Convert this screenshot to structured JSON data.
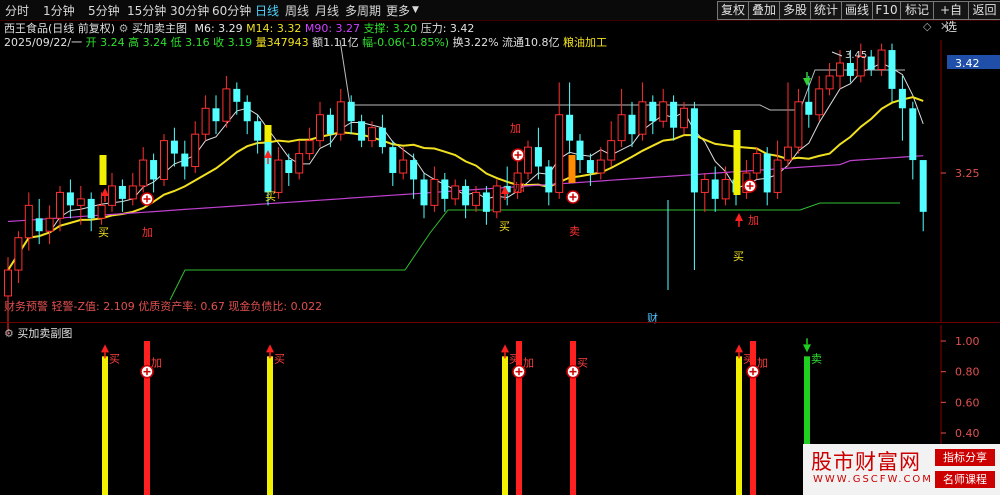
{
  "toolbar": {
    "periods": [
      "分时",
      "1分钟",
      "5分钟",
      "15分钟",
      "30分钟",
      "60分钟",
      "日线",
      "周线",
      "月线",
      "多周期",
      "更多"
    ],
    "active": "日线",
    "right_buttons": [
      "复权",
      "叠加",
      "多股",
      "统计",
      "画线",
      "F10",
      "标记",
      "+自选",
      "返回"
    ]
  },
  "info": {
    "stock": "西王食品(日线 前复权)",
    "indicator": "买加卖主图",
    "m6": "M6: 3.29",
    "m14": "M14: 3.32",
    "m90": "M90: 3.27",
    "support": "支撑: 3.20",
    "pressure": "压力: 3.42",
    "date": "2025/09/22/一",
    "open": "开 3.24",
    "high": "高 3.24",
    "low": "低 3.16",
    "close": "收 3.19",
    "volume": "量347943",
    "amount": "额1.11亿",
    "change": "幅-0.06(-1.85%)",
    "turnover": "换3.22%",
    "float": "流通10.8亿",
    "industry": "粮油加工"
  },
  "main_chart": {
    "price_labels": [
      "3.42",
      "3.25"
    ],
    "peak_label": "3.45",
    "financial_note": "财务预警 轻警-Z值: 2.109 优质资产率: 0.67 现金负债比: 0.022",
    "financial_marker": "财",
    "signals": [
      {
        "text": "买",
        "color": "#f0e020"
      },
      {
        "text": "加",
        "color": "#ff3030"
      },
      {
        "text": "买",
        "color": "#f0e020"
      },
      {
        "text": "买",
        "color": "#f0e020"
      },
      {
        "text": "加",
        "color": "#ff3030"
      },
      {
        "text": "卖",
        "color": "#ff3030"
      },
      {
        "text": "加",
        "color": "#ff3030"
      },
      {
        "text": "买",
        "color": "#f0e020"
      },
      {
        "text": "加",
        "color": "#ff3030"
      }
    ]
  },
  "sub_chart": {
    "title": "买加卖副图",
    "axis_labels": [
      "1.00",
      "0.80",
      "0.60",
      "0.40"
    ],
    "bar_labels": [
      "买",
      "加",
      "买",
      "买",
      "加",
      "买",
      "买",
      "加",
      "卖"
    ]
  },
  "watermark": {
    "title": "股市财富网",
    "url": "WWW.GSCFW.COM",
    "tag1": "指标分享",
    "tag2": "名师课程"
  },
  "chart_data": {
    "type": "candlestick",
    "axis_ticks": [
      3.42,
      3.25
    ],
    "candles": [
      [
        3.06,
        3.1,
        3.0,
        3.12
      ],
      [
        3.1,
        3.15,
        3.08,
        3.16
      ],
      [
        3.15,
        3.2,
        3.13,
        3.22
      ],
      [
        3.18,
        3.16,
        3.14,
        3.21
      ],
      [
        3.16,
        3.18,
        3.14,
        3.2
      ],
      [
        3.18,
        3.22,
        3.16,
        3.23
      ],
      [
        3.22,
        3.2,
        3.18,
        3.24
      ],
      [
        3.2,
        3.21,
        3.17,
        3.23
      ],
      [
        3.21,
        3.18,
        3.16,
        3.22
      ],
      [
        3.18,
        3.2,
        3.17,
        3.22
      ],
      [
        3.2,
        3.23,
        3.19,
        3.25
      ],
      [
        3.23,
        3.21,
        3.19,
        3.24
      ],
      [
        3.21,
        3.23,
        3.2,
        3.25
      ],
      [
        3.23,
        3.27,
        3.22,
        3.29
      ],
      [
        3.27,
        3.24,
        3.22,
        3.28
      ],
      [
        3.24,
        3.3,
        3.23,
        3.31
      ],
      [
        3.3,
        3.28,
        3.26,
        3.32
      ],
      [
        3.28,
        3.26,
        3.24,
        3.3
      ],
      [
        3.26,
        3.31,
        3.25,
        3.33
      ],
      [
        3.31,
        3.35,
        3.3,
        3.37
      ],
      [
        3.35,
        3.33,
        3.31,
        3.37
      ],
      [
        3.33,
        3.38,
        3.32,
        3.4
      ],
      [
        3.38,
        3.36,
        3.34,
        3.39
      ],
      [
        3.36,
        3.33,
        3.31,
        3.37
      ],
      [
        3.33,
        3.3,
        3.28,
        3.34
      ],
      [
        3.3,
        3.22,
        3.2,
        3.31
      ],
      [
        3.22,
        3.27,
        3.21,
        3.29
      ],
      [
        3.27,
        3.25,
        3.23,
        3.28
      ],
      [
        3.25,
        3.28,
        3.24,
        3.3
      ],
      [
        3.28,
        3.3,
        3.27,
        3.32
      ],
      [
        3.3,
        3.34,
        3.29,
        3.36
      ],
      [
        3.34,
        3.31,
        3.29,
        3.35
      ],
      [
        3.31,
        3.36,
        3.3,
        3.38
      ],
      [
        3.36,
        3.33,
        3.31,
        3.37
      ],
      [
        3.33,
        3.3,
        3.29,
        3.34
      ],
      [
        3.3,
        3.32,
        3.29,
        3.33
      ],
      [
        3.32,
        3.29,
        3.28,
        3.34
      ],
      [
        3.29,
        3.25,
        3.23,
        3.3
      ],
      [
        3.25,
        3.27,
        3.24,
        3.29
      ],
      [
        3.27,
        3.24,
        3.21,
        3.28
      ],
      [
        3.24,
        3.2,
        3.18,
        3.25
      ],
      [
        3.2,
        3.24,
        3.19,
        3.26
      ],
      [
        3.24,
        3.21,
        3.19,
        3.25
      ],
      [
        3.21,
        3.23,
        3.2,
        3.24
      ],
      [
        3.23,
        3.2,
        3.18,
        3.24
      ],
      [
        3.2,
        3.22,
        3.19,
        3.23
      ],
      [
        3.22,
        3.19,
        3.17,
        3.23
      ],
      [
        3.19,
        3.23,
        3.18,
        3.24
      ],
      [
        3.23,
        3.22,
        3.2,
        3.26
      ],
      [
        3.22,
        3.25,
        3.21,
        3.27
      ],
      [
        3.25,
        3.29,
        3.24,
        3.3
      ],
      [
        3.29,
        3.26,
        3.24,
        3.32
      ],
      [
        3.26,
        3.22,
        3.2,
        3.27
      ],
      [
        3.22,
        3.34,
        3.21,
        3.39
      ],
      [
        3.34,
        3.3,
        3.28,
        3.39
      ],
      [
        3.3,
        3.27,
        3.25,
        3.31
      ],
      [
        3.27,
        3.25,
        3.23,
        3.28
      ],
      [
        3.25,
        3.27,
        3.24,
        3.29
      ],
      [
        3.27,
        3.3,
        3.26,
        3.33
      ],
      [
        3.3,
        3.34,
        3.29,
        3.38
      ],
      [
        3.34,
        3.31,
        3.29,
        3.36
      ],
      [
        3.31,
        3.36,
        3.3,
        3.39
      ],
      [
        3.36,
        3.33,
        3.31,
        3.37
      ],
      [
        3.33,
        3.36,
        3.32,
        3.38
      ],
      [
        3.36,
        3.32,
        3.3,
        3.37
      ],
      [
        3.32,
        3.35,
        3.31,
        3.36
      ],
      [
        3.35,
        3.22,
        3.1,
        3.36
      ],
      [
        3.22,
        3.24,
        3.19,
        3.25
      ],
      [
        3.24,
        3.21,
        3.19,
        3.26
      ],
      [
        3.21,
        3.24,
        3.2,
        3.26
      ],
      [
        3.24,
        3.22,
        3.2,
        3.25
      ],
      [
        3.22,
        3.25,
        3.21,
        3.27
      ],
      [
        3.25,
        3.28,
        3.24,
        3.29
      ],
      [
        3.28,
        3.22,
        3.2,
        3.29
      ],
      [
        3.22,
        3.27,
        3.21,
        3.3
      ],
      [
        3.27,
        3.29,
        3.26,
        3.39
      ],
      [
        3.29,
        3.36,
        3.28,
        3.38
      ],
      [
        3.36,
        3.34,
        3.32,
        3.4
      ],
      [
        3.34,
        3.38,
        3.33,
        3.4
      ],
      [
        3.38,
        3.4,
        3.37,
        3.42
      ],
      [
        3.4,
        3.42,
        3.38,
        3.44
      ],
      [
        3.42,
        3.4,
        3.39,
        3.44
      ],
      [
        3.4,
        3.43,
        3.39,
        3.45
      ],
      [
        3.43,
        3.41,
        3.4,
        3.44
      ],
      [
        3.41,
        3.44,
        3.4,
        3.45
      ],
      [
        3.44,
        3.38,
        3.36,
        3.45
      ],
      [
        3.38,
        3.35,
        3.3,
        3.4
      ],
      [
        3.35,
        3.27,
        3.24,
        3.36
      ],
      [
        3.27,
        3.19,
        3.16,
        3.24
      ]
    ],
    "signal_bars": [
      {
        "height": 0.9,
        "color": "#f0f000"
      },
      {
        "height": 1.0,
        "color": "#ff2020"
      },
      {
        "height": 0.9,
        "color": "#f0f000"
      },
      {
        "height": 0.9,
        "color": "#f0f000"
      },
      {
        "height": 1.0,
        "color": "#ff2020"
      },
      {
        "height": 1.0,
        "color": "#ff2020"
      },
      {
        "height": 0.9,
        "color": "#f0f000"
      },
      {
        "height": 1.0,
        "color": "#ff2020"
      },
      {
        "height": 0.9,
        "color": "#20d020"
      }
    ]
  }
}
